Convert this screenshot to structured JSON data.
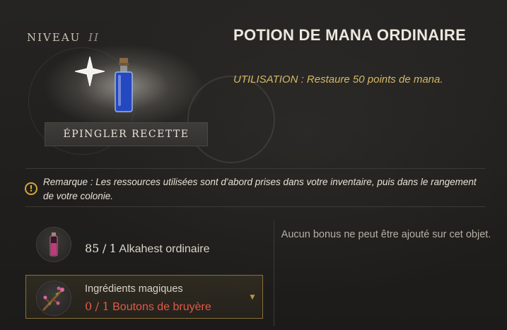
{
  "item": {
    "level_label": "NIVEAU",
    "level_value": "II",
    "title": "POTION DE MANA ORDINAIRE",
    "usage": "UTILISATION : Restaure 50 points de mana.",
    "pin_button": "ÉPINGLER RECETTE"
  },
  "note": {
    "icon": "warning-circle-icon",
    "text": "Remarque : Les ressources utilisées sont d'abord prises dans votre inventaire, puis dans le rangement de votre colonie."
  },
  "ingredients": [
    {
      "icon": "small-potion-icon",
      "have": "85",
      "sep": "/",
      "need": "1",
      "name": "Alkahest ordinaire"
    },
    {
      "icon": "heather-sprig-icon",
      "category": "Ingrédients magiques",
      "have": "0",
      "sep": "/",
      "need": "1",
      "name": "Boutons de bruyère",
      "status_color": "#e05a4a"
    }
  ],
  "bonus": {
    "text": "Aucun bonus ne peut être ajouté sur cet objet."
  },
  "colors": {
    "title": "#ece8de",
    "usage": "#d6b766",
    "missing": "#e05a4a",
    "highlight_border": "#8a6f38"
  }
}
